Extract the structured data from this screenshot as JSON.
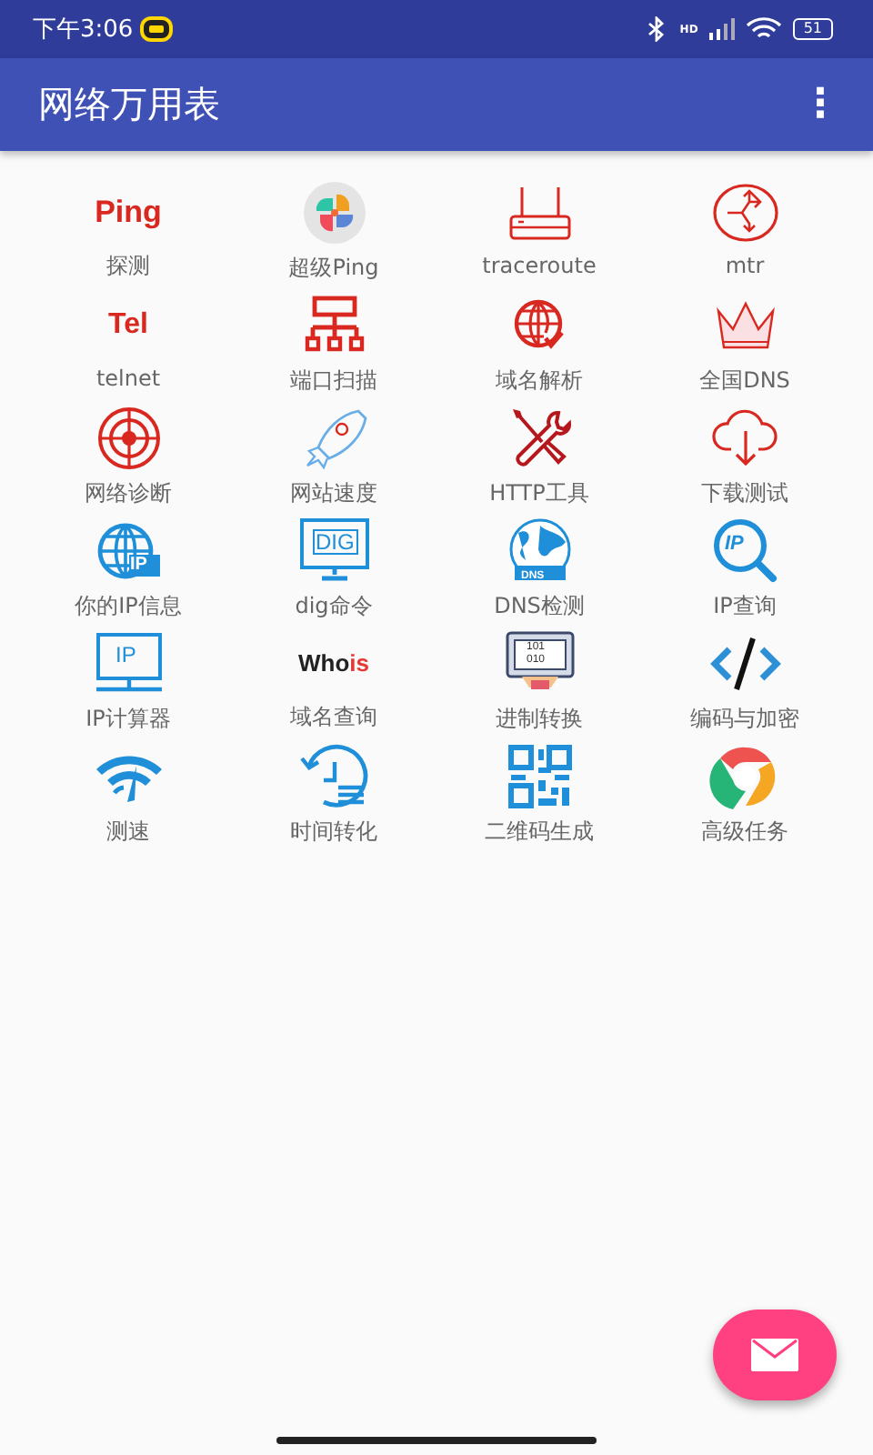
{
  "status_bar": {
    "time": "下午3:06",
    "network": "HD",
    "battery": "51"
  },
  "app_bar": {
    "title": "网络万用表",
    "menu": "⋮"
  },
  "tools": [
    {
      "label": "探测",
      "kind": "text",
      "icon_text": [
        "Ping"
      ]
    },
    {
      "label": "超级Ping",
      "kind": "petals"
    },
    {
      "label": "traceroute",
      "kind": "router"
    },
    {
      "label": "mtr",
      "kind": "arrows"
    },
    {
      "label": "telnet",
      "kind": "text",
      "icon_text": [
        "Tel"
      ]
    },
    {
      "label": "端口扫描",
      "kind": "tree"
    },
    {
      "label": "域名解析",
      "kind": "globecheck"
    },
    {
      "label": "全国DNS",
      "kind": "crown"
    },
    {
      "label": "网络诊断",
      "kind": "target"
    },
    {
      "label": "网站速度",
      "kind": "rocket"
    },
    {
      "label": "HTTP工具",
      "kind": "tools"
    },
    {
      "label": "下载测试",
      "kind": "cloud"
    },
    {
      "label": "你的IP信息",
      "kind": "globeip",
      "icon_text": [
        "IP"
      ]
    },
    {
      "label": "dig命令",
      "kind": "monitordig",
      "icon_text": [
        "DIG"
      ]
    },
    {
      "label": "DNS检测",
      "kind": "earth",
      "icon_text": [
        "DNS"
      ]
    },
    {
      "label": "IP查询",
      "kind": "magnifier",
      "icon_text": [
        "IP"
      ]
    },
    {
      "label": "IP计算器",
      "kind": "monitorip",
      "icon_text": [
        "IP"
      ]
    },
    {
      "label": "域名查询",
      "kind": "text2",
      "icon_text": [
        "Who",
        "is"
      ]
    },
    {
      "label": "进制转换",
      "kind": "binary",
      "icon_text": [
        "101",
        "010"
      ]
    },
    {
      "label": "编码与加密",
      "kind": "code"
    },
    {
      "label": "测速",
      "kind": "gauge"
    },
    {
      "label": "时间转化",
      "kind": "history"
    },
    {
      "label": "二维码生成",
      "kind": "qr"
    },
    {
      "label": "高级任务",
      "kind": "chrome"
    }
  ]
}
